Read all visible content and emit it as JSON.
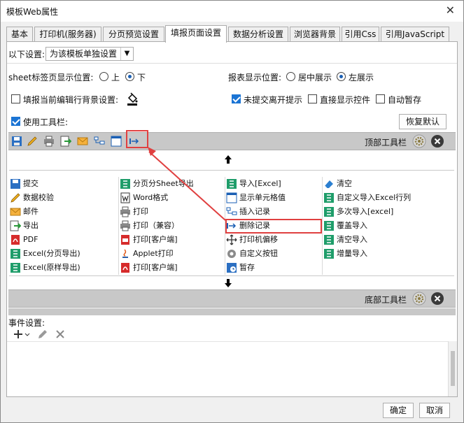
{
  "window": {
    "title": "模板Web属性"
  },
  "tabs": [
    "基本",
    "打印机(服务器)",
    "分页预览设置",
    "填报页面设置",
    "数据分析设置",
    "浏览器背景",
    "引用Css",
    "引用JavaScript"
  ],
  "settings": {
    "scope_label": "以下设置:",
    "scope_value": "为该模板单独设置",
    "sheet_label": "sheet标签页显示位置:",
    "sheet_top": "上",
    "sheet_bottom": "下",
    "report_label": "报表显示位置:",
    "report_center": "居中展示",
    "report_left": "左展示",
    "fill_bg_label": "填报当前编辑行背景设置:",
    "unsubmitted_label": "未提交离开提示",
    "direct_controls_label": "直接显示控件",
    "autosave_label": "自动暂存",
    "use_toolbar_label": "使用工具栏:",
    "restore_default": "恢复默认"
  },
  "top_toolbar": {
    "label": "顶部工具栏"
  },
  "bottom_toolbar": {
    "label": "底部工具栏"
  },
  "items": {
    "col1": [
      "提交",
      "数据校验",
      "邮件",
      "导出",
      "PDF",
      "Excel(分页导出)",
      "Excel(原样导出)"
    ],
    "col2": [
      "分页分Sheet导出",
      "Word格式",
      "打印",
      "打印（兼容）",
      "打印[客户端]",
      "Applet打印",
      "打印[客户端]"
    ],
    "col3": [
      "导入[Excel]",
      "显示单元格值",
      "插入记录",
      "删除记录",
      "打印机偏移",
      "自定义按钮",
      "暂存"
    ],
    "col4": [
      "清空",
      "自定义导入Excel行列",
      "多次导入[excel]",
      "覆盖导入",
      "清空导入",
      "增量导入"
    ]
  },
  "events": {
    "label": "事件设置:"
  },
  "footer": {
    "ok": "确定",
    "cancel": "取消"
  },
  "colors": {
    "toolbar_gray": "#c8c8c8",
    "highlight_red": "#e04040",
    "checkbox_blue": "#1b74d4"
  }
}
